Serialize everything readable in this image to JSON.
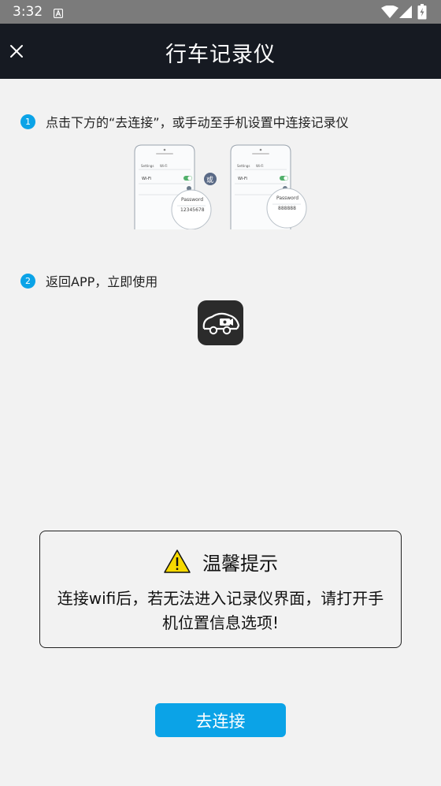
{
  "status_bar": {
    "time": "3:32"
  },
  "header": {
    "title": "行车记录仪"
  },
  "steps": [
    {
      "number": "1",
      "text": "点击下方的“去连接”，或手动至手机设置中连接记录仪"
    },
    {
      "number": "2",
      "text": "返回APP，立即使用"
    }
  ],
  "illustration": {
    "or_label": "或",
    "phone1": {
      "back": "Settings",
      "title": "Wi-Fi",
      "wifi_label": "Wi-Fi",
      "password_label": "Password",
      "password_value": "12345678"
    },
    "phone2": {
      "back": "Settings",
      "title": "Wi-Fi",
      "wifi_label": "Wi-Fi",
      "password_label": "Password",
      "password_value": "888888"
    }
  },
  "tips": {
    "title": "温馨提示",
    "message": "连接wifi后，若无法进入记录仪界面，请打开手机位置信息选项!"
  },
  "connect_button": {
    "label": "去连接"
  },
  "colors": {
    "accent": "#0ba3e7",
    "header_bg": "#161a22",
    "status_bg": "#7b7b7b",
    "page_bg": "#f2f2f2"
  }
}
